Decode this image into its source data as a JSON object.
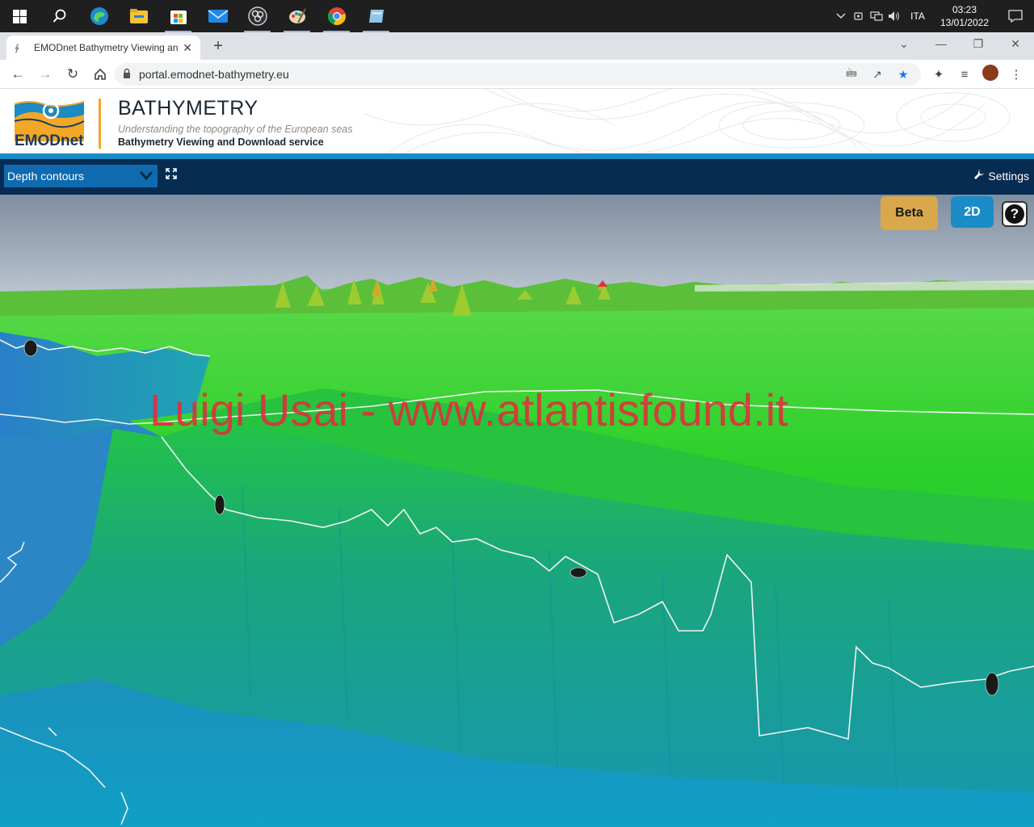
{
  "taskbar": {
    "apps": [
      {
        "icon": "windows-start-icon"
      },
      {
        "icon": "search-icon"
      },
      {
        "icon": "edge-icon"
      },
      {
        "icon": "file-explorer-icon"
      },
      {
        "icon": "microsoft-store-icon"
      },
      {
        "icon": "mail-icon"
      },
      {
        "icon": "obs-icon"
      },
      {
        "icon": "paint-icon"
      },
      {
        "icon": "chrome-icon"
      },
      {
        "icon": "notes-icon"
      }
    ],
    "language": "ITA",
    "time": "03:23",
    "date": "13/01/2022"
  },
  "browser": {
    "tab_title": "EMODnet Bathymetry Viewing an",
    "url": "portal.emodnet-bathymetry.eu"
  },
  "site": {
    "logo_text": "EMODnet",
    "title": "BATHYMETRY",
    "subtitle": "Understanding the topography of the European seas",
    "service": "Bathymetry Viewing and Download service",
    "colors": {
      "band": "#1a8bc4",
      "bar": "#072c52",
      "accent": "#f0a826"
    }
  },
  "app": {
    "layer_select": "Depth contours",
    "settings_label": "Settings",
    "beta_label": "Beta",
    "view_toggle_label": "2D",
    "help_label": "?",
    "overlay_text": "Luigi Usai - www.atlantisfound.it"
  }
}
